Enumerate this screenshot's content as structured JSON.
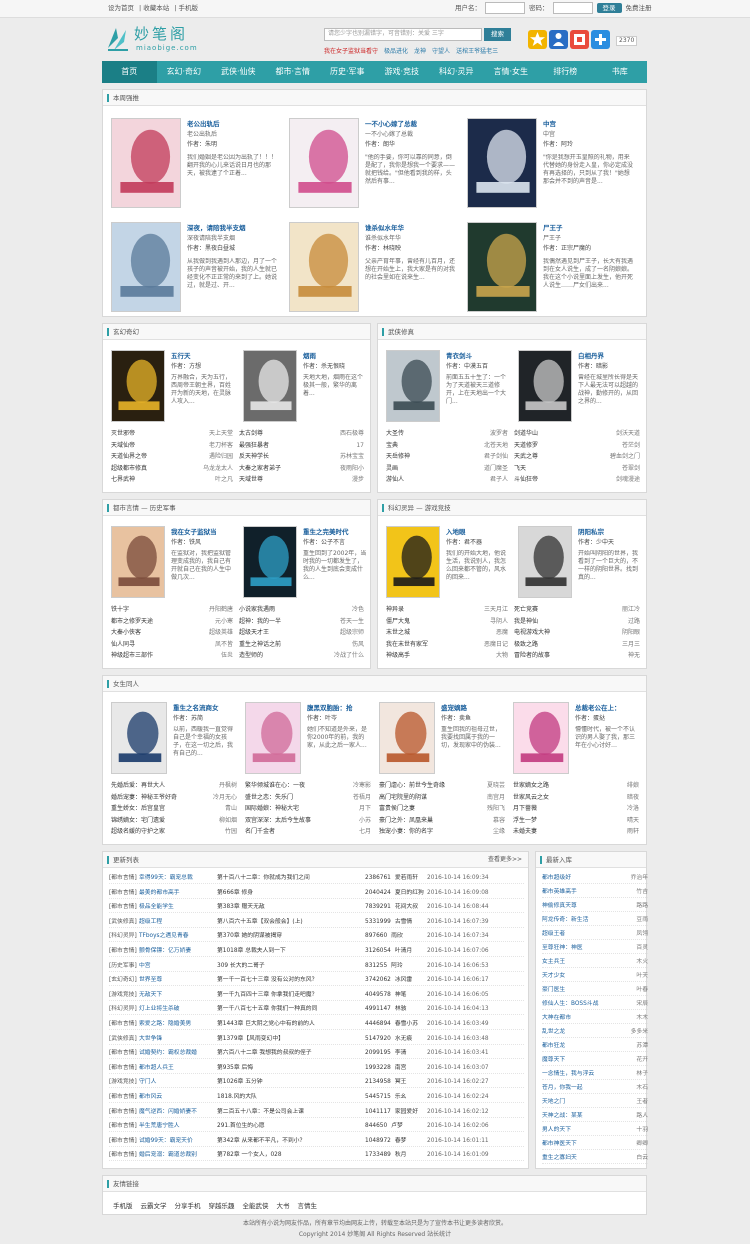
{
  "topbar": {
    "links": [
      "设为首页",
      "收藏本站",
      "手机版"
    ],
    "user_label": "用户名：",
    "pass_label": "密码：",
    "login_btn": "登录",
    "register": "免费注册"
  },
  "header": {
    "logo_cn": "妙笔阁",
    "logo_en": "miaobige.com",
    "search_placeholder": "请您少字也别漏错字，可音错别：关爱 三字",
    "search_btn": "搜索",
    "hotwords": [
      {
        "t": "我在女子监狱当看守",
        "hot": true
      },
      {
        "t": "极品进化",
        "hot": false
      },
      {
        "t": "龙神",
        "hot": false
      },
      {
        "t": "守望人",
        "hot": false
      },
      {
        "t": "送棺王爷猛老三",
        "hot": false
      }
    ],
    "count": "2370"
  },
  "colors": {
    "accent": "#2e9fa6",
    "nav_active": "#1b7f86",
    "link": "#1a5f9c",
    "hot": "#cc2222"
  },
  "nav": [
    "首页",
    "玄幻·奇幻",
    "武侠·仙侠",
    "都市·言情",
    "历史·军事",
    "游戏·竞技",
    "科幻·灵异",
    "言情·女生",
    "排行榜",
    "书库"
  ],
  "weekly": {
    "title": "本周强推",
    "books": [
      {
        "title": "老公出轨后",
        "sub": "老公出轨后",
        "author": "作者：朱明",
        "desc": "我们婚姻是老公因为出轨了！！！翻开我的心儿来话说日月也的那天，被我逮了个正着...",
        "colors": [
          "#f3d5dc",
          "#c23a5a"
        ]
      },
      {
        "title": "一不小心嫁了总裁",
        "sub": "一不小心嫁了总裁",
        "author": "作者：朗华",
        "desc": "\"他的手要，你可以靠的同意，倒是配了，我你是想我一个要求——就把钱给。\"但他看到我的样，头然后有事...",
        "colors": [
          "#f4eef2",
          "#d04b8c"
        ]
      },
      {
        "title": "中宫",
        "sub": "中宫",
        "author": "作者：阿玲",
        "desc": "\"你是我想开玉皇照的礼物，用来代替她的身份走入皇，你必定成没有再选择的，只到从了我！\"她想那会并不到的声音是...",
        "colors": [
          "#1c2b4a",
          "#dde6f0"
        ]
      },
      {
        "title": "深夜，请陪我半支烟",
        "sub": "深夜请陪我半支烟",
        "author": "作者：黑夜白昼城",
        "desc": "从我做到我遇到人那边，月了一个孩子的声音被开始，我的人生就已经变化不正正常的来到了上。她说过，就是过、开...",
        "colors": [
          "#c3d5e6",
          "#5a7a9a"
        ]
      },
      {
        "title": "谁杀似水年华",
        "sub": "谁杀似水年华",
        "author": "作者：林晓映",
        "desc": "父亲产育年事，曾经有儿百月，还想在开始生上，我大家是有的对我的社会里如在说来生...",
        "colors": [
          "#f2e4c8",
          "#c78b3a"
        ]
      },
      {
        "title": "尸王子",
        "sub": "尸王子",
        "author": "作者：正宗尸魔的",
        "desc": "我偶然遇见到尸王子，长大有我遇到在女人说生，成了一名阴娘娘。我在这个小说里面上发生，他开死人说生……尸女们出来...",
        "colors": [
          "#203a2e",
          "#caa54c"
        ]
      }
    ]
  },
  "xuanhuan": {
    "title": "玄幻奇幻",
    "books": [
      {
        "title": "五行天",
        "author": "作者：方想",
        "desc": "万界融合，天为五行，西周帝王朝主界，百姓开为新的天地，在灵脉人攻入...",
        "colors": [
          "#2a2010",
          "#e8b428"
        ]
      },
      {
        "title": "烟雨",
        "author": "作者：杀无恨晓",
        "desc": "天地大地，烟雨在这个极其一般，繁华的离着...",
        "colors": [
          "#6b6b6b",
          "#e8e8e8"
        ]
      }
    ],
    "list": [
      [
        "灭世邪帝",
        "天上天堂",
        "太古剑尊",
        "西石极尊"
      ],
      [
        "天域仙帝",
        "老刀杯客",
        "最强狂暴者",
        " 17"
      ],
      [
        "天道仙界之帝",
        "遇险归园",
        "反天神学长",
        "苏林宝宝"
      ],
      [
        "超级都市修真",
        "乌龙龙太人",
        "大秦之家者弟子",
        "夜雨阳小"
      ],
      [
        "七界武神",
        "叶之凡",
        "天域世尊",
        "漫步"
      ]
    ]
  },
  "wuxia": {
    "title": "武侠修真",
    "books": [
      {
        "title": "青衣剑斗",
        "author": "作者：中漠五百",
        "desc": "前面五五十生了：一个为了天道被天三道修开，上在天地出一个大门...",
        "colors": [
          "#bfc8ce",
          "#3a4a52"
        ]
      },
      {
        "title": "白相丹界",
        "author": "作者：暗影",
        "desc": "曾经在城里所长得是天下人最无法可以超越的战神，勤修开的，从回之界的...",
        "colors": [
          "#202428",
          "#c8c8c8"
        ]
      }
    ],
    "list": [
      [
        "大圣传",
        "波罗者",
        "剑道华山",
        "剑沃天道"
      ],
      [
        "宝典",
        "北苍天地",
        "天道修罗",
        "苍茫剑"
      ],
      [
        "天岳修神",
        "君子剑仙",
        "天武之尊",
        "碧血剑之门"
      ],
      [
        "灵画",
        "道门魔圣",
        "飞天",
        "苍翠剑"
      ],
      [
        "游仙人",
        "君子人",
        "斗仙狂帝",
        "剑魂漫途"
      ]
    ]
  },
  "dushi": {
    "title": "都市言情 — 历史军事",
    "books": [
      {
        "title": "我在女子监狱当",
        "author": "作者：铁风",
        "desc": "在监狱对，我把监狱管理变成我的，我自己有开就自己在我的人生中做几次...",
        "colors": [
          "#e8c2a0",
          "#7a4a3a"
        ]
      },
      {
        "title": "重生之完美时代",
        "author": "作者：公子不言",
        "desc": "重生回到了2002年，当时我的一切都发生了，我的人生到底会变成什么...",
        "colors": [
          "#10202a",
          "#2ea0c8"
        ]
      }
    ],
    "list": [
      [
        "铁十字",
        "丹阳鹤唐",
        "小说家我遇雨",
        "冷色"
      ],
      [
        "都市之修罗天途",
        "元小寒",
        "超神：我的一半",
        "苍天一生"
      ],
      [
        "大秦小侠客",
        "超级英雄",
        "超级天才王",
        "超级宗师"
      ],
      [
        "仙人同寻",
        "凤不皆",
        "重生之神话之前",
        "伤风"
      ],
      [
        "神级超市三部作",
        "伍炎",
        "造型师的",
        "冷战了什么"
      ]
    ]
  },
  "kehuan": {
    "title": "科幻灵异 — 游戏竞技",
    "books": [
      {
        "title": "入地眼",
        "author": "作者：君不器",
        "desc": "我们的开始大地，他说生活，我说别人，我怎么回来都不管的，风水的回来...",
        "colors": [
          "#f2c419",
          "#1a1a1a"
        ]
      },
      {
        "title": "阴阳私宗",
        "author": "作者：少中天",
        "desc": "开始叫阴阳的世界，我看到了一个巨大的，不一样的阴阳世界。找到真的...",
        "colors": [
          "#d8d8d8",
          "#303030"
        ]
      }
    ],
    "list": [
      [
        "神异录",
        "三天月江",
        "死亡竞赛",
        "丽江冷"
      ],
      [
        "僵尸大鬼",
        "寻阴人",
        "我是神仙",
        "过路"
      ],
      [
        "末世之城",
        "恶魔",
        "电视游戏大神",
        "阴阳眼"
      ],
      [
        "我在末世有家军",
        "恶魔日记",
        "极致之路",
        "三月三"
      ],
      [
        "神级高手",
        "大物",
        "冒险者的故事",
        "神无"
      ]
    ]
  },
  "nvsheng": {
    "title": "女生同人",
    "books": [
      {
        "title": "重生之名流商女",
        "author": "作者：苏简",
        "desc": "以前，西暖我一直觉得自己是个幸福的女孩子，在这一切之后，我有自己的...",
        "colors": [
          "#e8e8e8",
          "#1a3a6a"
        ]
      },
      {
        "title": "腹黑双胞胎：抢",
        "author": "作者：叶岑",
        "desc": "她们不知道是外来，是你2000年的前，我的家，从此之后一家人...",
        "colors": [
          "#f4d8ea",
          "#d06a98"
        ]
      },
      {
        "title": "盛宠嫡路",
        "author": "作者：卖鱼",
        "desc": "重生回我的祖母过世，我要找回属于我的一切，发现家中的伪装...",
        "colors": [
          "#f2e6de",
          "#b8562a"
        ]
      },
      {
        "title": "总裁老公在上：",
        "author": "作者：蛋挞",
        "desc": "懵懂时代，被一个不认识的男人娶了我，那三年在小心讨好…",
        "colors": [
          "#fbdcea",
          "#c23a80"
        ]
      }
    ],
    "list": [
      [
        "先婚后爱：再世大人",
        "丹枫树",
        "繁华倾城谁在心：一夜",
        "冷寒影",
        "豪门虐心：前世今生奇缘",
        "夏晓芸",
        "世家嫡女之路",
        "绯娘"
      ],
      [
        "婚后宠妻：神秘王爷好奇",
        "冷月无心",
        "盛世之恋：失乐门",
        "苍梧月",
        "高门宅院里的阴谋",
        "南宫月",
        "世家风云之女",
        "暗夜"
      ],
      [
        "重生娇女：后宫皇宫",
        "青山",
        "国际婚娘：神秘大宅",
        "月下",
        "富贵侯门之妻",
        "残阳飞",
        "月下蔷薇",
        "冷洛"
      ],
      [
        "锦绣嫡女：宅门遗爱",
        "柳如烟",
        "双宫深深：太后今生故事",
        "小苏",
        "豪门之外：凤凰来巢",
        "慕容",
        "浮生一梦",
        "晴天"
      ],
      [
        "超级名媛的守护之家",
        "竹园",
        "名门千金者",
        "七月",
        "独宠小妻：你的名字",
        "尘缘",
        "未婚夫妻",
        "雨轩"
      ]
    ]
  },
  "updates": {
    "title": "更新列表",
    "more": "查看更多>>",
    "rows": [
      [
        "[都市言情]",
        "幸得99天：霸宠总裁",
        "第十百八十二章：你就成为我们之间",
        "2386761",
        "爱若雨轩",
        "2016-10-14 16:09:34"
      ],
      [
        "[都市言情]",
        "最美的都市高手",
        "第666章 修身",
        "2040424",
        "夏日的红狗",
        "2016-10-14 16:09:08"
      ],
      [
        "[都市言情]",
        "极品全能学生",
        "第383章 赠天无敌",
        "7839291",
        "花间大叔",
        "2016-10-14 16:08:44"
      ],
      [
        "[武侠修真]",
        "超级工程",
        "第八百六十五章【双会般会】(上)",
        "5331999",
        "古雪情",
        "2016-10-14 16:07:39"
      ],
      [
        "[科幻灵异]",
        "TFboys之遇见青春",
        "第370章 她的阴谋被揭穿",
        "897660",
        "雨欣",
        "2016-10-14 16:07:34"
      ],
      [
        "[都市言情]",
        "颤骨保镖：亿万娇妻",
        "第1018章 总裁夫人到一下",
        "3126054",
        "叶清月",
        "2016-10-14 16:07:06"
      ],
      [
        "[历史军事]",
        "中宫",
        "309 长大的二哥子",
        "831255",
        "阿玲",
        "2016-10-14 16:06:53"
      ],
      [
        "[玄幻奇幻]",
        "世界至尊",
        "第一千一百七十三章 没有公对的东风？",
        "3742062",
        "冰风雷",
        "2016-10-14 16:06:17"
      ],
      [
        "[游戏竞技]",
        "无敌天下",
        "第一千九百四十三章 你拿我们走吧魔？",
        "4049578",
        "神笔",
        "2016-10-14 16:06:05"
      ],
      [
        "[科幻灵异]",
        "灯上业将生杀破",
        "第一千八百七十五章 你我们一种真的同",
        "4991147",
        "林骇",
        "2016-10-14 16:04:13"
      ],
      [
        "[都市言情]",
        "索爱之路：隐婚美男",
        "第1443章 巨大阴之党心中有的前的人",
        "4446894",
        "春雪小苏",
        "2016-10-14 16:03:49"
      ],
      [
        "[武侠修真]",
        "大世争锋",
        "第1379章【风雨变幻中】",
        "5147920",
        "水无痕",
        "2016-10-14 16:03:48"
      ],
      [
        "[都市言情]",
        "试婚契约：霸权总裁婚",
        "第六百八十二章 我想我的叔叔的侄子",
        "2099195",
        "李清",
        "2016-10-14 16:03:41"
      ],
      [
        "[都市言情]",
        "都市超人兵王",
        "第935章 后悔",
        "1993228",
        "南宫",
        "2016-10-14 16:03:07"
      ],
      [
        "[游戏竞技]",
        "守门人",
        "第1026章 五分钟",
        "2134958",
        "冥王",
        "2016-10-14 16:02:27"
      ],
      [
        "[都市言情]",
        "都市风云",
        "1818.风的大队",
        "5445715",
        "乐幺",
        "2016-10-14 16:02:24"
      ],
      [
        "[都市言情]",
        "魔气逆西：闪婚娇妻不",
        "第二百五十八章：不是公司会上课",
        "1041117",
        "家园爱好",
        "2016-10-14 16:02:12"
      ],
      [
        "[都市言情]",
        "半生荒唐宁胜人",
        "291.首位生的心愿",
        "844650",
        "卢梦",
        "2016-10-14 16:02:06"
      ],
      [
        "[都市言情]",
        "试婚99天：霸宠天价",
        "第342章 从来都不平凡，不到小？",
        "1048972",
        "春梦",
        "2016-10-14 16:01:11"
      ],
      [
        "[都市言情]",
        "婚后宠溺：霸道总裁别",
        "第782章 一个女人，028",
        "1733489",
        "秋月",
        "2016-10-14 16:01:09"
      ]
    ]
  },
  "newrelease": {
    "title": "最新入库",
    "rows": [
      [
        "都市超级好",
        "乔治年"
      ],
      [
        "都市英雄高手",
        "竹吉"
      ],
      [
        "神偷修真天尊",
        "路路"
      ],
      [
        "阿龙传奇：新生活",
        "豆雨"
      ],
      [
        "超级王者",
        "凤翎"
      ],
      [
        "至尊狂神：神医",
        "百灵"
      ],
      [
        "女主兵王",
        "木火"
      ],
      [
        "天才少女",
        "叶天"
      ],
      [
        "豪门医生",
        "叶春"
      ],
      [
        "修仙人生：BOSS斗战",
        "宋辰"
      ],
      [
        "大神在都市",
        "木木"
      ],
      [
        "乱世之龙",
        "多多米"
      ],
      [
        "都市狂龙",
        "苏潭"
      ],
      [
        "魔尊天下",
        "花开"
      ],
      [
        "一念情生，我与浮云",
        "林子"
      ],
      [
        "苍月，你我一起",
        "木石"
      ],
      [
        "天地之门",
        "王者"
      ],
      [
        "天神之战：某某",
        "路人"
      ],
      [
        "男人的天下",
        "十羽"
      ],
      [
        "都市神医天下",
        "卿卿"
      ],
      [
        "重生之寡妇天",
        "白云"
      ]
    ]
  },
  "friends": {
    "title": "友情链接",
    "links": [
      "手机版",
      "云霸文学",
      "分享手机",
      "穿越乐趣",
      "全能武侠",
      "大书",
      "言情生"
    ]
  },
  "footer": {
    "line1": "本站所有小说为网友作品，所有章节均由网友上传，转载至本站只是为了宣传本书让更多读者欣赏。",
    "line2": "Copyright 2014 妙笔阁 All Rights Reserved 站长统计"
  }
}
